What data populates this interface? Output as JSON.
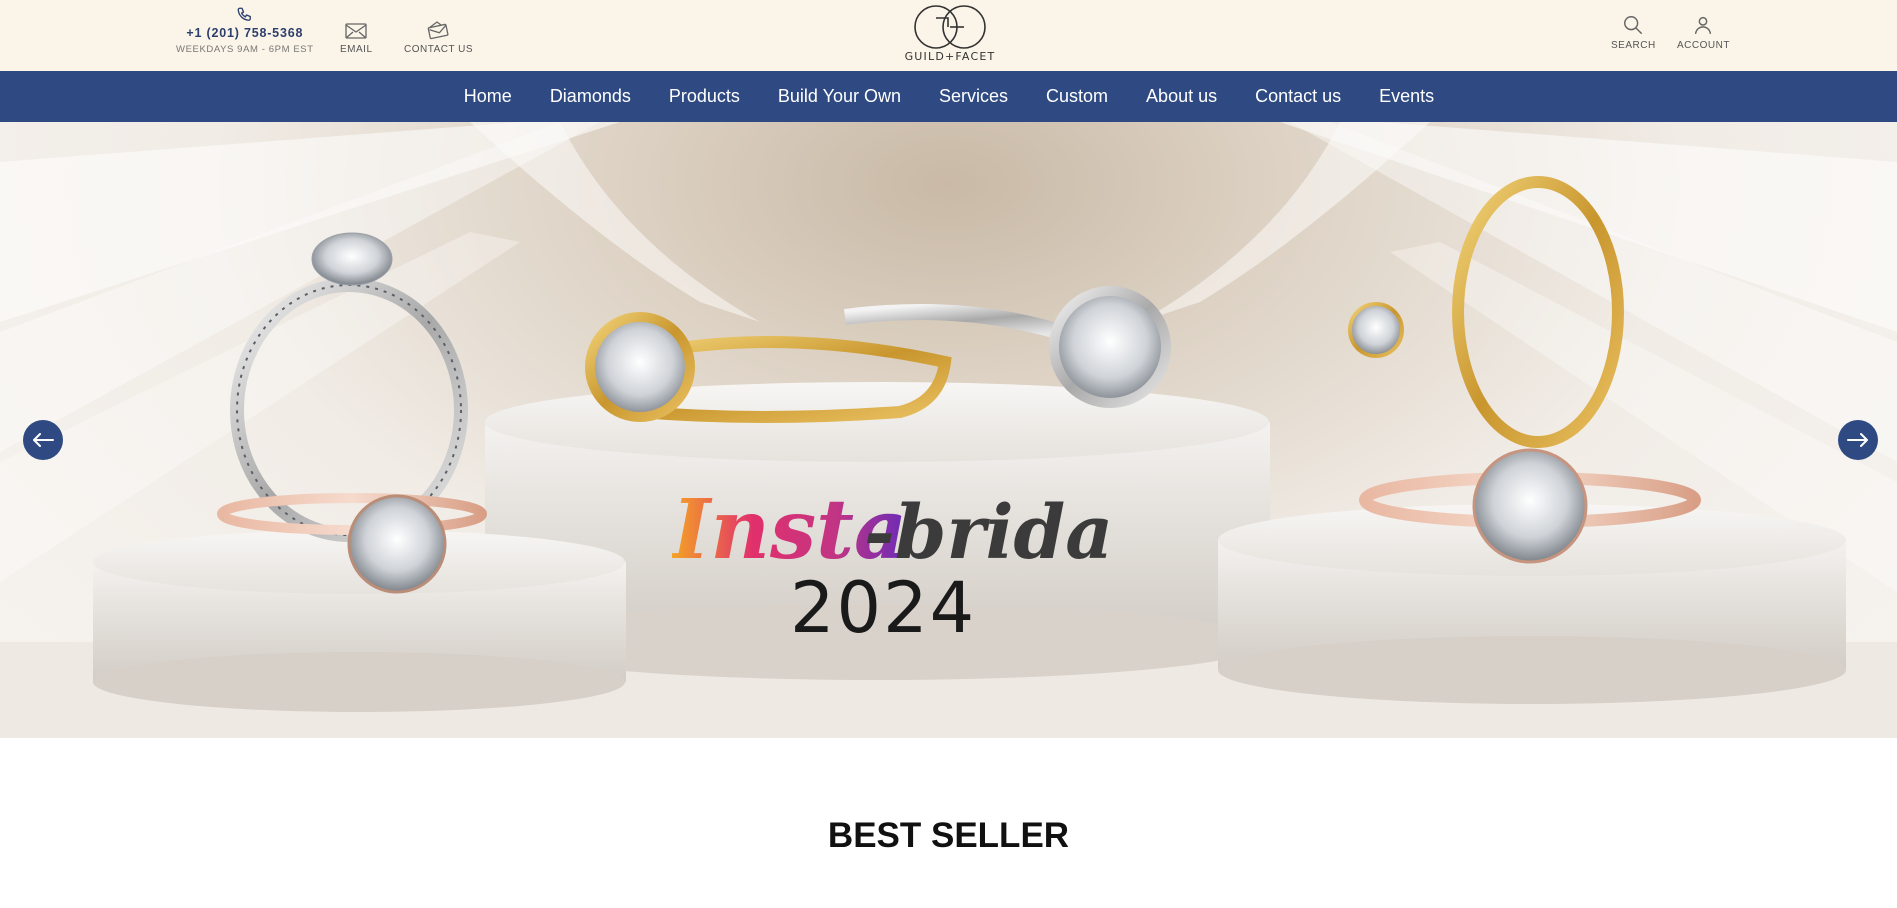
{
  "header": {
    "phone_number": "+1 (201) 758-5368",
    "phone_hours": "WEEKDAYS 9AM - 6PM EST",
    "email_label": "EMAIL",
    "contact_label": "CONTACT US",
    "search_label": "SEARCH",
    "account_label": "ACCOUNT",
    "logo_text": "GUILD+FACET"
  },
  "nav": {
    "items": [
      "Home",
      "Diamonds",
      "Products",
      "Build Your Own",
      "Services",
      "Custom",
      "About us",
      "Contact us",
      "Events"
    ]
  },
  "hero": {
    "title_part1": "Insta",
    "title_part2": "-bridal",
    "year": "2024"
  },
  "sections": {
    "best_seller": "BEST SELLER"
  },
  "colors": {
    "topbar_bg": "#fbf4e8",
    "nav_bg": "#2f4a82",
    "accent": "#2f4a82"
  },
  "icons": {
    "phone": "phone-icon",
    "email": "envelope-icon",
    "contact": "open-envelope-icon",
    "search": "search-icon",
    "account": "user-icon",
    "prev": "arrow-left-icon",
    "next": "arrow-right-icon"
  }
}
